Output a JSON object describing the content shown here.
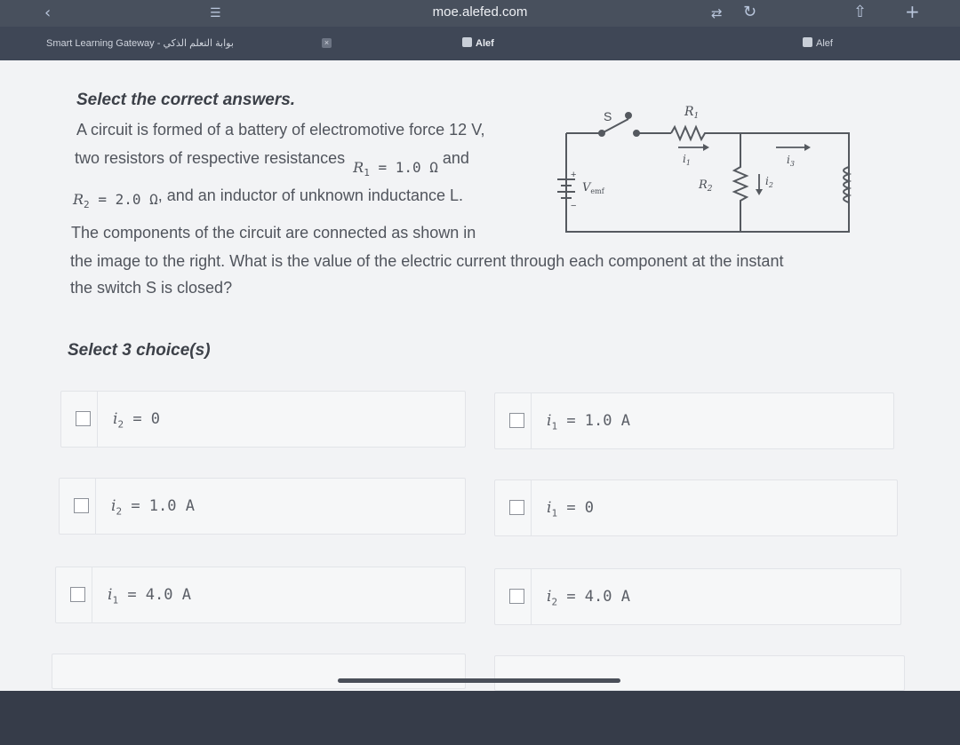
{
  "browser": {
    "url": "moe.alefed.com",
    "tabs": [
      {
        "label": "Smart Learning Gateway - بوابة التعلم الذكي"
      },
      {
        "label": "Alef"
      },
      {
        "label": "Alef"
      }
    ]
  },
  "question": {
    "instruction": "Select the correct answers.",
    "line1": "A circuit is formed of a battery of electromotive force 12 V,",
    "line2a": "two resistors of respective resistances",
    "r1_expr": "= 1.0 Ω",
    "and1": "and",
    "r2_expr": "= 2.0 Ω",
    "line3b": ", and an inductor of unknown inductance L.",
    "line4": "The components of the circuit are connected as shown in",
    "line5": "the image to the right. What is the value of the electric current through each component at the instant",
    "line6": "the switch S is closed?"
  },
  "select_count": "Select 3 choice(s)",
  "choices": [
    {
      "var": "i",
      "sub": "2",
      "value": "= 0"
    },
    {
      "var": "i",
      "sub": "1",
      "value": "= 1.0 A"
    },
    {
      "var": "i",
      "sub": "2",
      "value": "= 1.0 A"
    },
    {
      "var": "i",
      "sub": "1",
      "value": "= 0"
    },
    {
      "var": "i",
      "sub": "1",
      "value": "= 4.0 A"
    },
    {
      "var": "i",
      "sub": "2",
      "value": "= 4.0 A"
    }
  ],
  "circuit": {
    "switch": "S",
    "r1": "R",
    "r1_sub": "1",
    "r2": "R",
    "r2_sub": "2",
    "vemf": "V",
    "vemf_sub": "emf",
    "i1": "i",
    "i1_sub": "1",
    "i2": "i",
    "i2_sub": "2",
    "i3": "i",
    "i3_sub": "3",
    "inductor": "L",
    "plus": "+",
    "minus": "−"
  }
}
